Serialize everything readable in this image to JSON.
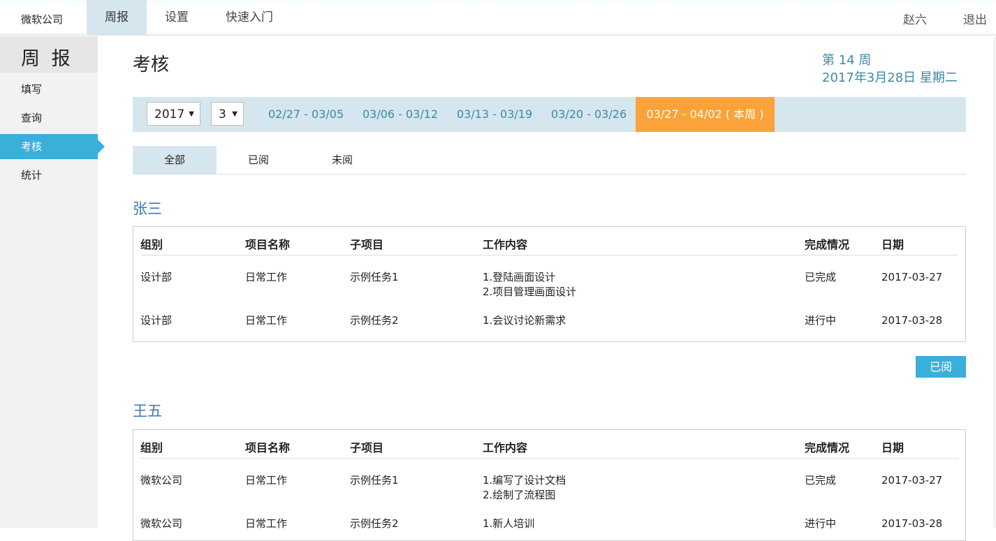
{
  "topbar": {
    "brand": "微软公司",
    "nav": [
      "周报",
      "设置",
      "快速入门"
    ],
    "user": "赵六",
    "logout": "退出"
  },
  "sidebar": {
    "title": "周 报",
    "items": [
      "填写",
      "查询",
      "考核",
      "统计"
    ],
    "active_item": "考核"
  },
  "main": {
    "title": "考核",
    "week_number": "第 14 周",
    "date": "2017年3月28日 星期二",
    "year": "2017",
    "month": "3",
    "weeks": [
      "02/27 - 03/05",
      "03/06 - 03/12",
      "03/13 - 03/19",
      "03/20 - 03/26"
    ],
    "current_week": "03/27 - 04/02 ( 本周 )",
    "filters": [
      "全部",
      "已阅",
      "未阅"
    ],
    "active_filter": "全部"
  },
  "columns": [
    "组别",
    "项目名称",
    "子项目",
    "工作内容",
    "完成情况",
    "日期"
  ],
  "reports": [
    {
      "name": "张三",
      "rows": [
        {
          "group": "设计部",
          "project": "日常工作",
          "sub": "示例任务1",
          "content1": "1.登陆画面设计",
          "content2": "2.项目管理画面设计",
          "status": "已完成",
          "date": "2017-03-27"
        },
        {
          "group": "设计部",
          "project": "日常工作",
          "sub": "示例任务2",
          "content1": "1.会议讨论新需求",
          "content2": "",
          "status": "进行中",
          "date": "2017-03-28"
        }
      ],
      "button": "已阅"
    },
    {
      "name": "王五",
      "rows": [
        {
          "group": "微软公司",
          "project": "日常工作",
          "sub": "示例任务1",
          "content1": "1.编写了设计文档",
          "content2": "2.绘制了流程图",
          "status": "已完成",
          "date": "2017-03-27"
        },
        {
          "group": "微软公司",
          "project": "日常工作",
          "sub": "示例任务2",
          "content1": "1.新人培训",
          "content2": "",
          "status": "进行中",
          "date": "2017-03-28"
        }
      ]
    }
  ],
  "colors": {
    "accent": "#3aafd9",
    "link": "#3a8aa8",
    "current_week": "#fba33a",
    "bar": "#d5e6ee",
    "name": "#3a7ab0"
  }
}
